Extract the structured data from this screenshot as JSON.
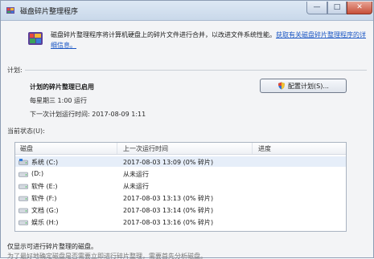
{
  "window": {
    "title": "磁盘碎片整理程序",
    "minimize_glyph": "—",
    "maximize_glyph": "□",
    "close_glyph": "✕"
  },
  "header": {
    "description": "磁盘碎片整理程序将计算机硬盘上的碎片文件进行合并，以改进文件系统性能。",
    "link_text": "获取有关磁盘碎片整理程序的详细信息。"
  },
  "schedule": {
    "section_label": "计划:",
    "enabled_text": "计划的碎片整理已启用",
    "run_time": "每星期三  1:00 运行",
    "next_run": "下一次计划运行时间: 2017-08-09 1:11",
    "config_button": "配置计划(S)..."
  },
  "status": {
    "section_label": "当前状态(U):",
    "columns": [
      "磁盘",
      "上一次运行时间",
      "进度"
    ],
    "rows": [
      {
        "disk": "系统 (C:)",
        "last_run": "2017-08-03 13:09 (0% 碎片)",
        "progress": "",
        "icon": "system-drive-icon",
        "selected": true
      },
      {
        "disk": "(D:)",
        "last_run": "从未运行",
        "progress": "",
        "icon": "drive-icon"
      },
      {
        "disk": "软件 (E:)",
        "last_run": "从未运行",
        "progress": "",
        "icon": "drive-icon"
      },
      {
        "disk": "软件 (F:)",
        "last_run": "2017-08-03 13:13 (0% 碎片)",
        "progress": "",
        "icon": "drive-icon"
      },
      {
        "disk": "文档 (G:)",
        "last_run": "2017-08-03 13:14 (0% 碎片)",
        "progress": "",
        "icon": "drive-icon"
      },
      {
        "disk": "娱乐 (H:)",
        "last_run": "2017-08-03 13:16 (0% 碎片)",
        "progress": "",
        "icon": "drive-icon"
      }
    ]
  },
  "footer": {
    "line1": "仅显示可进行碎片整理的磁盘。",
    "line2": "为了最好地确定磁盘是否需要立即进行碎片整理，需要首先分析磁盘。"
  },
  "colors": {
    "accent_link": "#1a56c4",
    "selected_row": "#e6eef9",
    "close_button": "#c7503a"
  }
}
